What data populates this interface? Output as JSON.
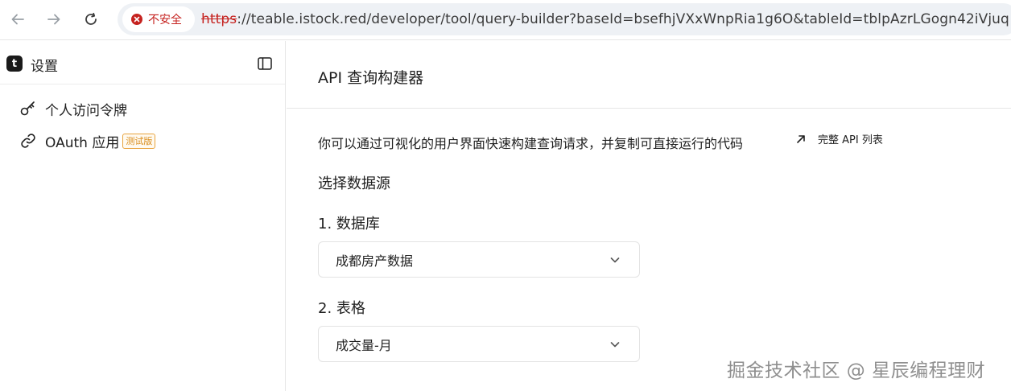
{
  "browser": {
    "security_label": "不安全",
    "url_scheme": "https",
    "url_rest": "://teable.istock.red/developer/tool/query-builder?baseId=bsefhjVXxWnpRia1g6O&tableId=tblpAzrLGogn42iVjuq"
  },
  "sidebar": {
    "title": "设置",
    "items": [
      {
        "label": "个人访问令牌",
        "icon": "key-icon"
      },
      {
        "label": "OAuth 应用",
        "icon": "link-icon",
        "badge": "测试版"
      }
    ]
  },
  "main": {
    "title": "API 查询构建器",
    "description": "你可以通过可视化的用户界面快速构建查询请求，并复制可直接运行的代码",
    "api_link": "完整 API 列表",
    "source_section": "选择数据源",
    "database": {
      "label": "1. 数据库",
      "value": "成都房产数据"
    },
    "table": {
      "label": "2. 表格",
      "value": "成交量-月"
    }
  },
  "watermark": "掘金技术社区 @ 星辰编程理财",
  "colors": {
    "insecure": "#c5221f",
    "badge": "#d98c1b",
    "border": "#e6e6e6"
  }
}
